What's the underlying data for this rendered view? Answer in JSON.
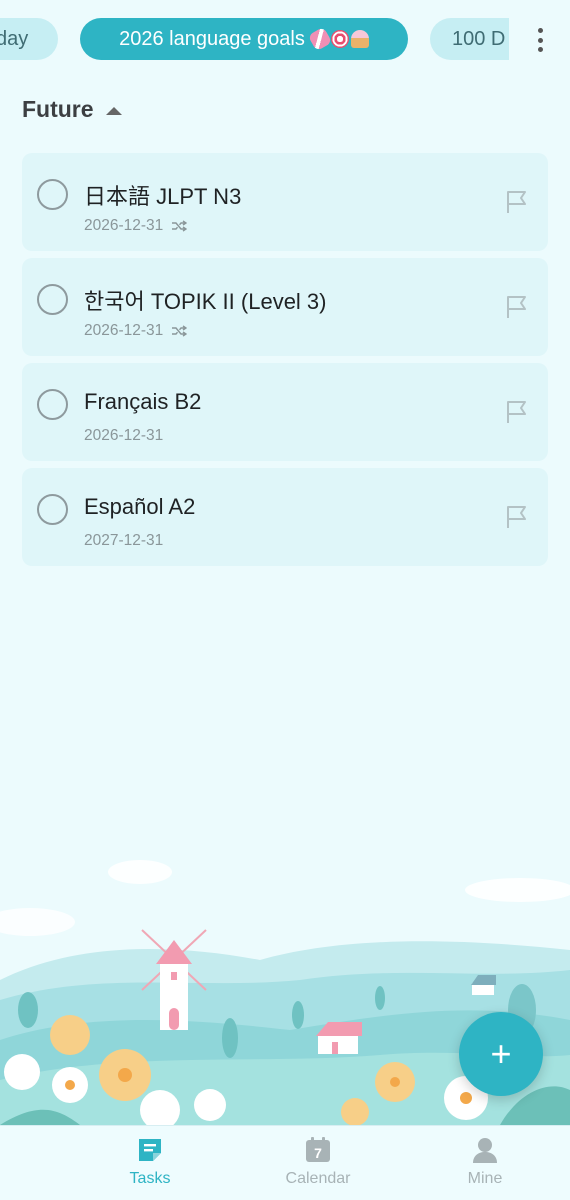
{
  "topbar": {
    "chips": [
      {
        "label": "day"
      },
      {
        "label": "2026 language goals"
      },
      {
        "label": "100 D"
      }
    ]
  },
  "section": {
    "title": "Future"
  },
  "tasks": [
    {
      "title": "日本語 JLPT N3",
      "date": "2026-12-31",
      "repeat": true
    },
    {
      "title": "한국어 TOPIK II (Level 3)",
      "date": "2026-12-31",
      "repeat": true
    },
    {
      "title": "Français B2",
      "date": "2026-12-31",
      "repeat": false
    },
    {
      "title": "Español A2",
      "date": "2027-12-31",
      "repeat": false
    }
  ],
  "fab": {
    "label": "+"
  },
  "nav": {
    "tasks": "Tasks",
    "calendar": "Calendar",
    "calendar_day": "7",
    "mine": "Mine"
  },
  "colors": {
    "accent": "#2eb4c4",
    "background": "#ecfbfd",
    "card": "#dff6f9"
  }
}
